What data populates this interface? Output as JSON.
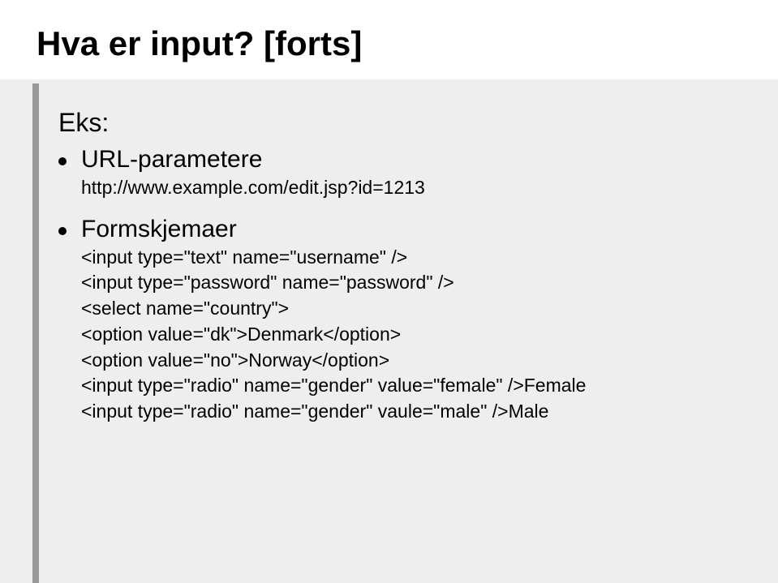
{
  "title": "Hva er input? [forts]",
  "subtitle": "Eks:",
  "bullets": [
    {
      "label": "URL-parametere",
      "code": [
        "http://www.example.com/edit.jsp?id=1213"
      ]
    },
    {
      "label": "Formskjemaer",
      "code": [
        "<input type=\"text\" name=\"username\" />",
        "<input type=\"password\" name=\"password\" />",
        "",
        "<select name=\"country\">",
        "<option value=\"dk\">Denmark</option>",
        "<option value=\"no\">Norway</option>",
        "",
        "<input type=\"radio\" name=\"gender\" value=\"female\" />Female",
        "<input type=\"radio\" name=\"gender\" vaule=\"male\" />Male"
      ]
    }
  ]
}
